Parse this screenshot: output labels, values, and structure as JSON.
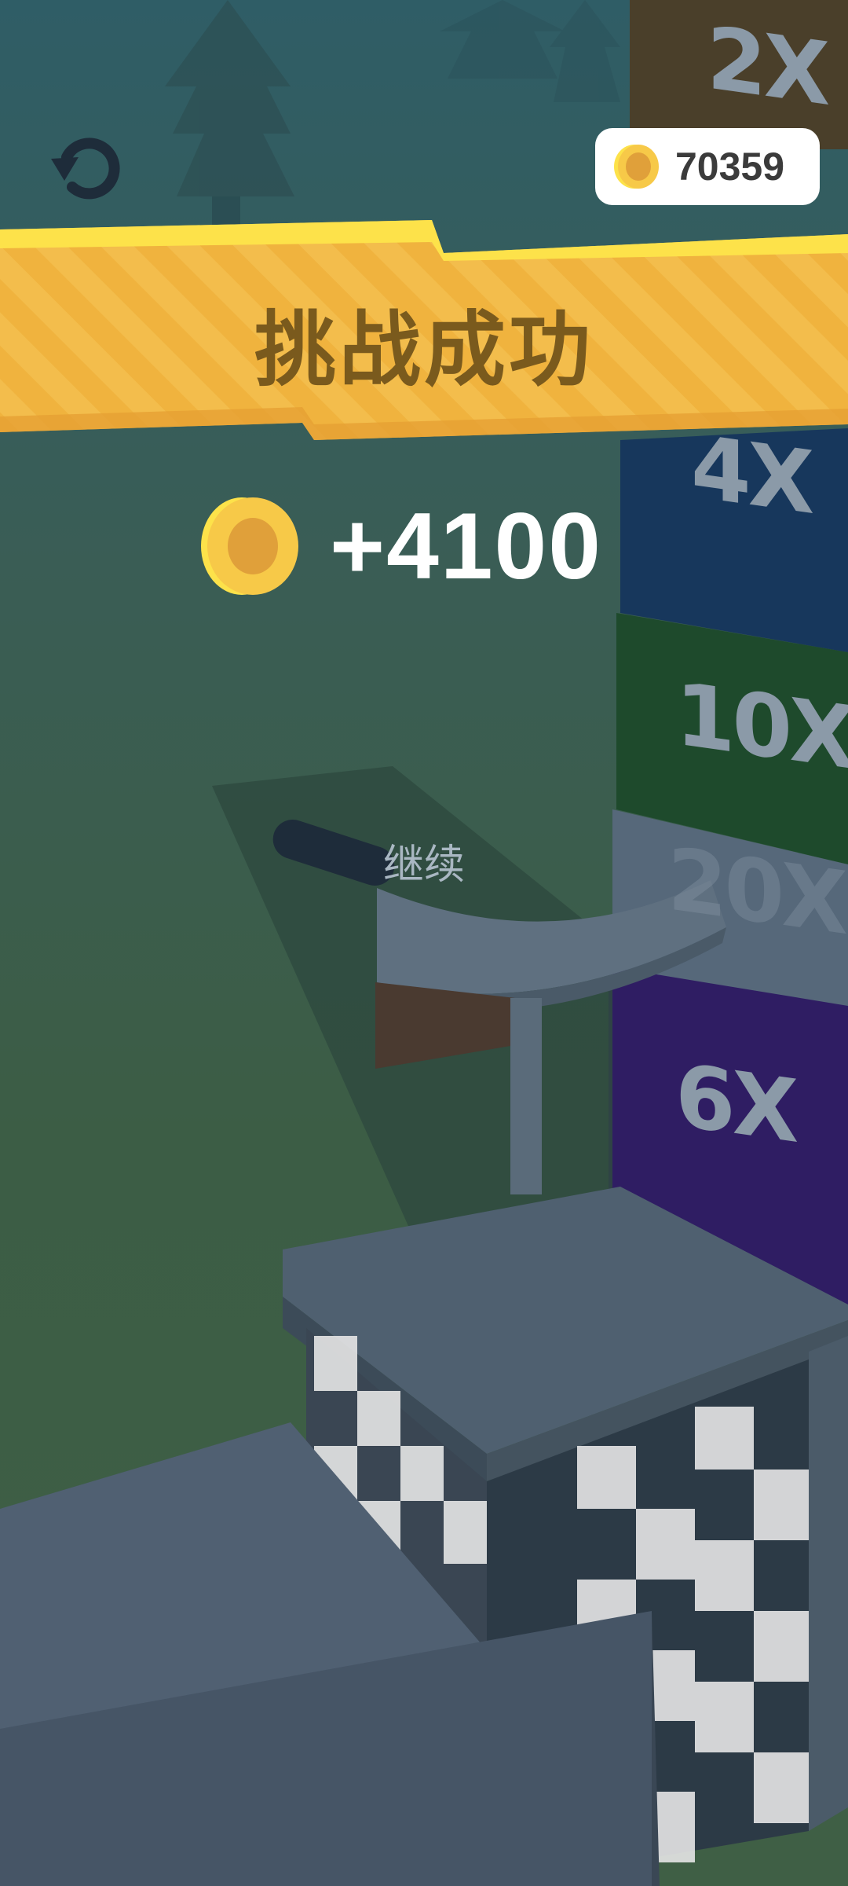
{
  "hud": {
    "coin_total": "70359",
    "restart_icon": "restart-icon",
    "coin_icon": "coin-icon"
  },
  "result": {
    "title": "挑战成功",
    "reward_amount": "+4100",
    "continue_label": "继续"
  },
  "multipliers": {
    "top": "2X",
    "second": "4X",
    "third": "10X",
    "fourth": "20X",
    "fifth": "6X"
  },
  "colors": {
    "banner_main": "#f2b33d",
    "banner_highlight": "#fde24a",
    "banner_text": "#7a5a1d",
    "coin_gold": "#f7c948",
    "coin_inner": "#e0a03a",
    "wall_blue": "#17375c",
    "wall_green": "#1e4a2c",
    "wall_purple": "#2f1d63",
    "wall_brown": "#4a3f2a"
  }
}
